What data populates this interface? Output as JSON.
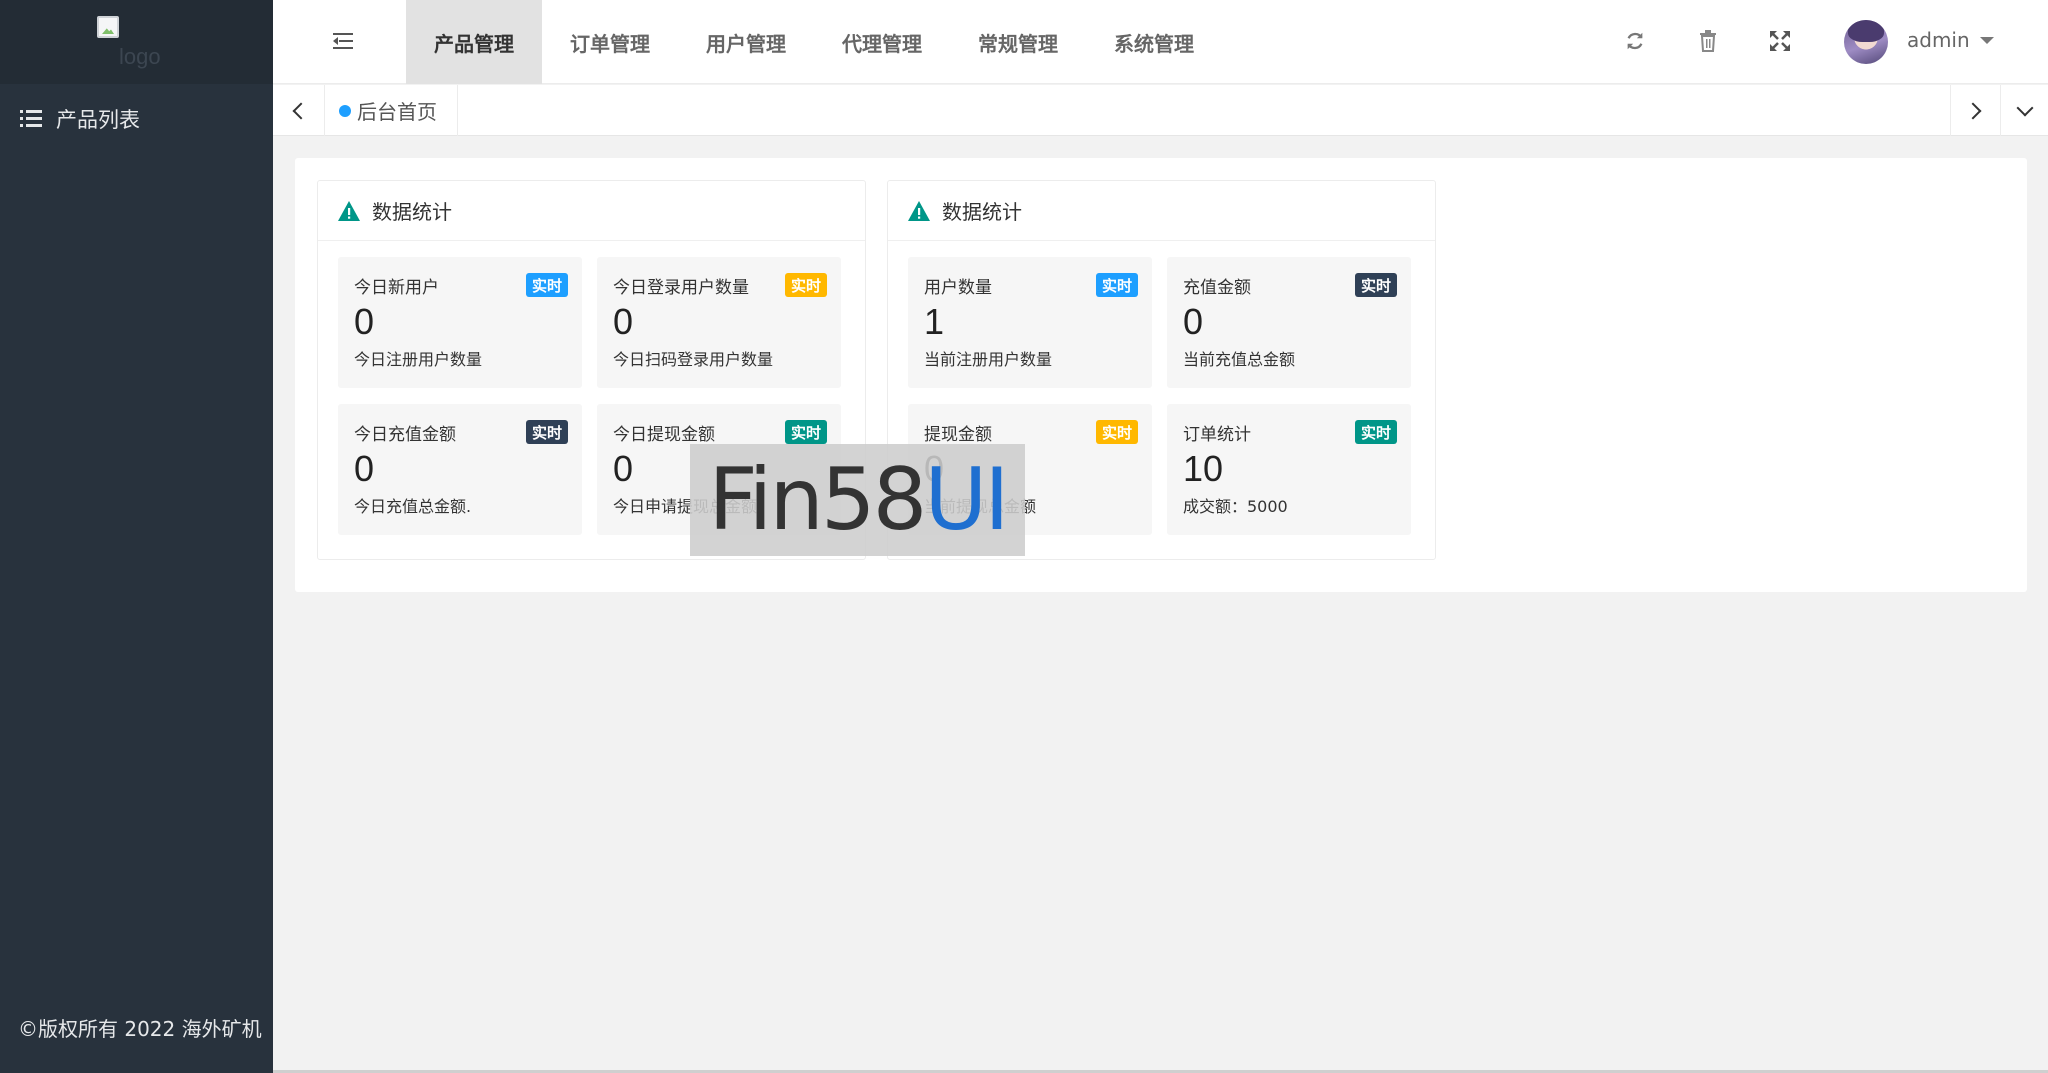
{
  "sidebar": {
    "logo_alt": "logo",
    "items": [
      {
        "label": "产品列表",
        "icon": "list-icon"
      }
    ],
    "copyright": "©版权所有 2022 海外矿机"
  },
  "header": {
    "menu_toggle_icon": "indent-icon",
    "nav": [
      {
        "label": "产品管理",
        "active": true
      },
      {
        "label": "订单管理",
        "active": false
      },
      {
        "label": "用户管理",
        "active": false
      },
      {
        "label": "代理管理",
        "active": false
      },
      {
        "label": "常规管理",
        "active": false
      },
      {
        "label": "系统管理",
        "active": false
      }
    ],
    "tools": [
      "refresh-icon",
      "trash-icon",
      "fullscreen-icon"
    ],
    "user": {
      "name": "admin"
    },
    "more_icon": "more-vertical-icon"
  },
  "tabbar": {
    "open_tab": {
      "label": "后台首页",
      "dot_color": "#1e9fff"
    }
  },
  "panels": [
    {
      "title": "数据统计",
      "stats": [
        {
          "title": "今日新用户",
          "badge": "实时",
          "badge_color": "#1e9fff",
          "value": "0",
          "desc": "今日注册用户数量"
        },
        {
          "title": "今日登录用户数量",
          "badge": "实时",
          "badge_color": "#ffb800",
          "value": "0",
          "desc": "今日扫码登录用户数量"
        },
        {
          "title": "今日充值金额",
          "badge": "实时",
          "badge_color": "#2f4056",
          "value": "0",
          "desc": "今日充值总金额."
        },
        {
          "title": "今日提现金额",
          "badge": "实时",
          "badge_color": "#009688",
          "value": "0",
          "desc": "今日申请提现总金额"
        }
      ]
    },
    {
      "title": "数据统计",
      "stats": [
        {
          "title": "用户数量",
          "badge": "实时",
          "badge_color": "#1e9fff",
          "value": "1",
          "desc": "当前注册用户数量"
        },
        {
          "title": "充值金额",
          "badge": "实时",
          "badge_color": "#2f4056",
          "value": "0",
          "desc": "当前充值总金额"
        },
        {
          "title": "提现金额",
          "badge": "实时",
          "badge_color": "#ffb800",
          "value": "0",
          "desc": "当前提现总金额"
        },
        {
          "title": "订单统计",
          "badge": "实时",
          "badge_color": "#009688",
          "value": "10",
          "desc": "成交额：5000"
        }
      ]
    }
  ],
  "watermark": {
    "part1": "Fin58",
    "part2": "UI"
  },
  "colors": {
    "sidebar": "#28323d",
    "accent": "#1e9fff",
    "warn_icon": "#009688"
  }
}
